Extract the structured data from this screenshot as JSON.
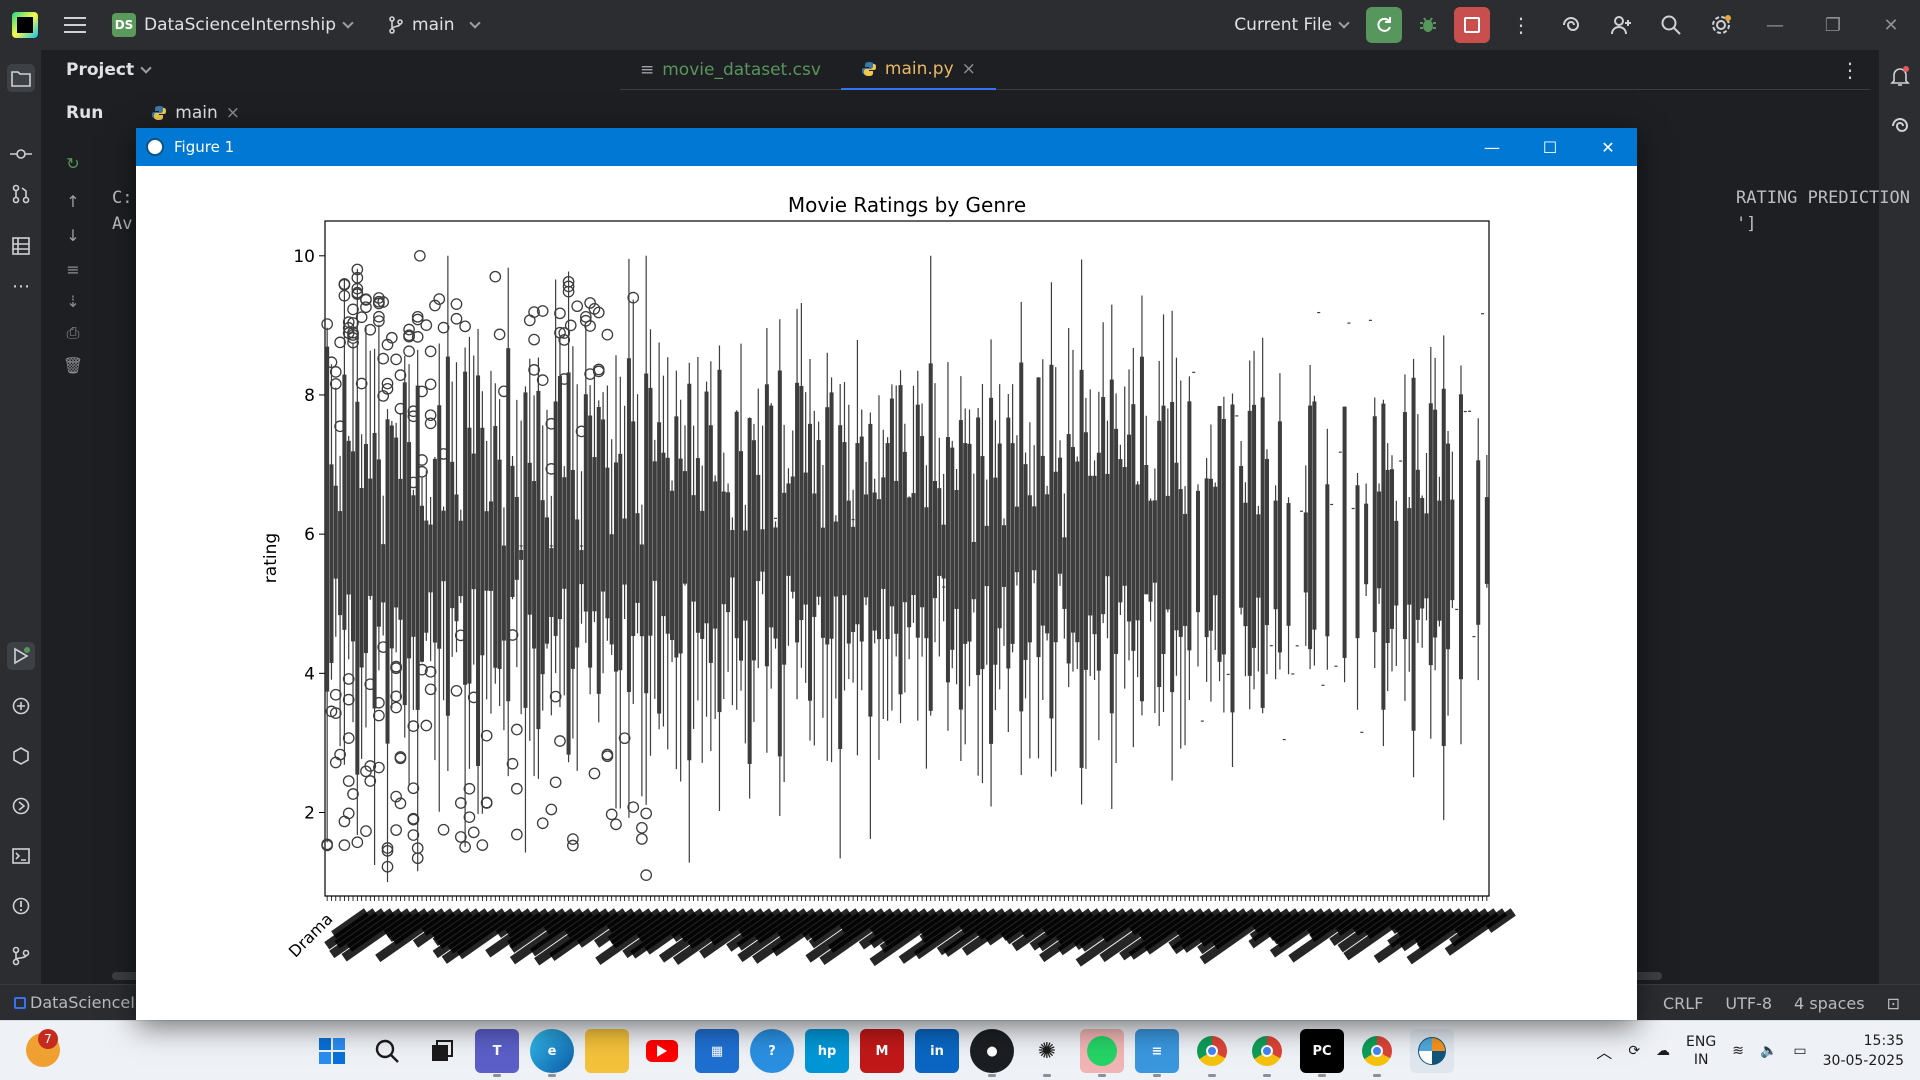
{
  "ide": {
    "project_badge": "DS",
    "project_name": "DataScienceInternship",
    "branch": "main",
    "run_config": "Current File",
    "project_panel_title": "Project",
    "editor_tabs": [
      {
        "label": "movie_dataset.csv",
        "icon": "csv-file-icon"
      },
      {
        "label": "main.py",
        "icon": "python-file-icon"
      }
    ],
    "tab_close": "×",
    "run_panel_title": "Run",
    "run_tab_label": "main",
    "console": {
      "line1": "C:",
      "line2": "Av",
      "line3": "RATING PREDICTION WITH",
      "line4": "']"
    },
    "status": {
      "project": "DataScienceIn",
      "line_ending": "CRLF",
      "encoding": "UTF-8",
      "indent": "4 spaces"
    },
    "colors": {
      "accent": "#3574f0",
      "run": "#57965c",
      "stop": "#c94f4f"
    }
  },
  "figure": {
    "window_title": "Figure 1",
    "controls": [
      "minimize",
      "maximize",
      "close"
    ]
  },
  "taskbar": {
    "notification_count": "7",
    "apps": [
      "windows-start",
      "search",
      "task-view",
      "teams",
      "edge",
      "file-explorer",
      "youtube",
      "microsoft-store",
      "support",
      "myhp",
      "mcafee",
      "linkedin",
      "github",
      "chatgpt",
      "whatsapp",
      "notepad",
      "chrome",
      "chrome-profile",
      "pycharm",
      "chrome-profile-2",
      "matplotlib"
    ],
    "language_line1": "ENG",
    "language_line2": "IN",
    "time": "15:35",
    "date": "30-05-2025"
  },
  "chart_data": {
    "type": "box",
    "title": "Movie Ratings by Genre",
    "ylabel": "rating",
    "xlabel": "",
    "ylim": [
      0.8,
      10.5
    ],
    "yticks": [
      2,
      4,
      6,
      8,
      10
    ],
    "visible_categories": [
      "Drama"
    ],
    "category_count": "approx. 270 genre combinations (tick labels overlap and are illegible)",
    "global_median_line": 5.83,
    "box_color": "#3d3d3d",
    "outlier_marker": "open circle",
    "representative_boxes": [
      {
        "q1": 3.2,
        "median": 5.6,
        "q3": 8.1,
        "whisker_low": 1.6,
        "whisker_high": 9.6
      },
      {
        "q1": 4.6,
        "median": 5.8,
        "q3": 7.0,
        "whisker_low": 2.2,
        "whisker_high": 9.4
      },
      {
        "q1": 4.9,
        "median": 5.8,
        "q3": 6.8,
        "whisker_low": 1.8,
        "whisker_high": 9.2
      },
      {
        "q1": 5.0,
        "median": 5.8,
        "q3": 6.4,
        "whisker_low": 3.0,
        "whisker_high": 8.7
      },
      {
        "q1": 4.2,
        "median": 5.8,
        "q3": 7.7,
        "whisker_low": 2.0,
        "whisker_high": 9.3
      },
      {
        "q1": 4.5,
        "median": 6.1,
        "q3": 7.6,
        "whisker_low": 1.8,
        "whisker_high": 8.9
      },
      {
        "q1": 5.0,
        "median": 5.8,
        "q3": 6.5,
        "whisker_low": 2.7,
        "whisker_high": 8.4
      }
    ],
    "notable_outliers": [
      {
        "rating": 10.0
      },
      {
        "rating": 9.7
      },
      {
        "rating": 9.0
      },
      {
        "rating": 1.1
      }
    ]
  }
}
